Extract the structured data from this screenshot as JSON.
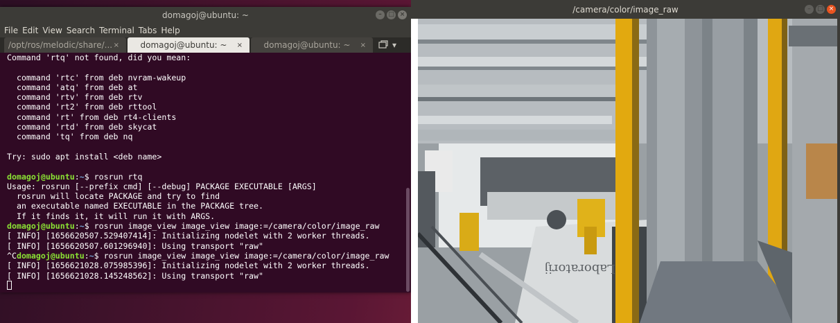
{
  "terminal": {
    "title": "domagoj@ubuntu: ~",
    "menu": [
      "File",
      "Edit",
      "View",
      "Search",
      "Terminal",
      "Tabs",
      "Help"
    ],
    "tabs": [
      {
        "label": "/opt/ros/melodic/share/...",
        "close": "×"
      },
      {
        "label": "domagoj@ubuntu: ~",
        "close": "×"
      },
      {
        "label": "domagoj@ubuntu: ~",
        "close": "×"
      }
    ],
    "lines": {
      "l1": "Command 'rtq' not found, did you mean:",
      "l2": "",
      "l3": "  command 'rtc' from deb nvram-wakeup",
      "l4": "  command 'atq' from deb at",
      "l5": "  command 'rtv' from deb rtv",
      "l6": "  command 'rt2' from deb rttool",
      "l7": "  command 'rt' from deb rt4-clients",
      "l8": "  command 'rtd' from deb skycat",
      "l9": "  command 'tq' from deb nq",
      "l10": "",
      "l11": "Try: sudo apt install <deb name>",
      "l12": "",
      "l13_user": "domagoj@ubuntu",
      "l13_sep": ":",
      "l13_path": "~",
      "l13_cmd": "$ rosrun rtq",
      "l14": "Usage: rosrun [--prefix cmd] [--debug] PACKAGE EXECUTABLE [ARGS]",
      "l15": "  rosrun will locate PACKAGE and try to find",
      "l16": "  an executable named EXECUTABLE in the PACKAGE tree.",
      "l17": "  If it finds it, it will run it with ARGS.",
      "l18_user": "domagoj@ubuntu",
      "l18_sep": ":",
      "l18_path": "~",
      "l18_cmd": "$ rosrun image_view image_view image:=/camera/color/image_raw",
      "l19": "[ INFO] [1656620507.529407414]: Initializing nodelet with 2 worker threads.",
      "l20": "[ INFO] [1656620507.601296940]: Using transport \"raw\"",
      "l21_pre": "^C",
      "l21_user": "domagoj@ubuntu",
      "l21_sep": ":",
      "l21_path": "~",
      "l21_cmd": "$ rosrun image_view image_view image:=/camera/color/image_raw",
      "l22": "[ INFO] [1656621028.075985396]: Initializing nodelet with 2 worker threads.",
      "l23": "[ INFO] [1656621028.145248562]: Using transport \"raw\""
    }
  },
  "image_window": {
    "title": "/camera/color/image_raw",
    "scene_text": "Laboratorij"
  },
  "colors": {
    "terminal_bg": "#300a24",
    "prompt_user": "#8ae234",
    "prompt_path": "#729fcf",
    "accent": "#e95420"
  }
}
